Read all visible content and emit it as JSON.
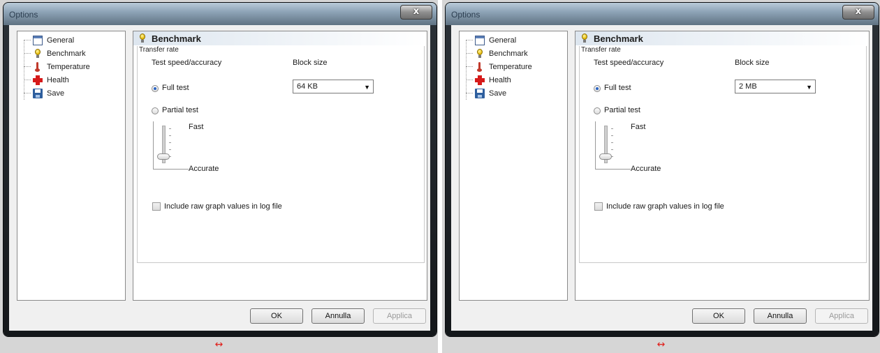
{
  "swap_symbol": "↔",
  "windows": [
    {
      "title": "Options",
      "close_label": "x",
      "tree": [
        {
          "label": "General",
          "icon": "window-icon"
        },
        {
          "label": "Benchmark",
          "icon": "lightbulb-icon"
        },
        {
          "label": "Temperature",
          "icon": "thermometer-icon"
        },
        {
          "label": "Health",
          "icon": "health-cross-icon"
        },
        {
          "label": "Save",
          "icon": "floppy-disk-icon"
        }
      ],
      "panel": {
        "title": "Benchmark",
        "group_legend": "Transfer rate",
        "test_speed_label": "Test speed/accuracy",
        "block_size_label": "Block size",
        "block_size_value": "64 KB",
        "full_test_label": "Full test",
        "full_test_checked": true,
        "partial_test_label": "Partial test",
        "slider_fast_label": "Fast",
        "slider_accurate_label": "Accurate",
        "include_raw_label": "Include raw graph values in log file",
        "include_raw_checked": false
      },
      "buttons": {
        "ok": "OK",
        "cancel": "Annulla",
        "apply": "Applica"
      }
    },
    {
      "title": "Options",
      "close_label": "x",
      "tree": [
        {
          "label": "General",
          "icon": "window-icon"
        },
        {
          "label": "Benchmark",
          "icon": "lightbulb-icon"
        },
        {
          "label": "Temperature",
          "icon": "thermometer-icon"
        },
        {
          "label": "Health",
          "icon": "health-cross-icon"
        },
        {
          "label": "Save",
          "icon": "floppy-disk-icon"
        }
      ],
      "panel": {
        "title": "Benchmark",
        "group_legend": "Transfer rate",
        "test_speed_label": "Test speed/accuracy",
        "block_size_label": "Block size",
        "block_size_value": "2 MB",
        "full_test_label": "Full test",
        "full_test_checked": true,
        "partial_test_label": "Partial test",
        "slider_fast_label": "Fast",
        "slider_accurate_label": "Accurate",
        "include_raw_label": "Include raw graph values in log file",
        "include_raw_checked": false
      },
      "buttons": {
        "ok": "OK",
        "cancel": "Annulla",
        "apply": "Applica"
      }
    }
  ]
}
